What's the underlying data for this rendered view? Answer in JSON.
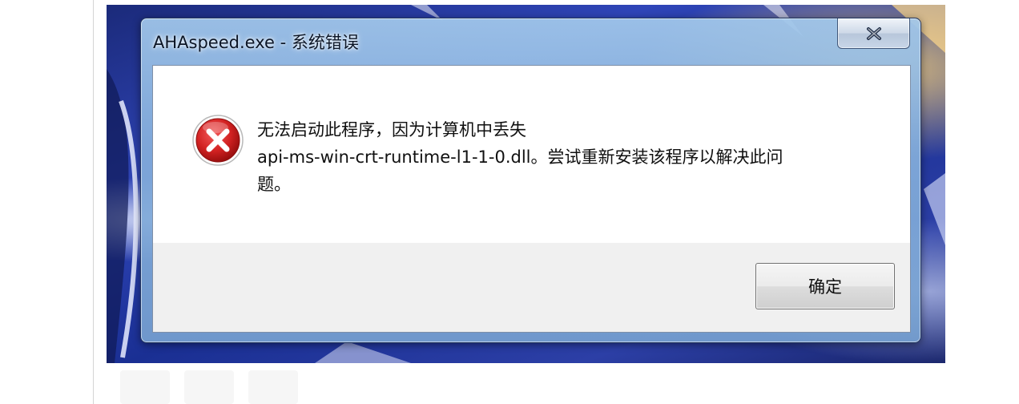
{
  "dialog": {
    "title": "AHAspeed.exe - 系统错误",
    "close_icon": "close-x-icon",
    "status_icon": "error-icon",
    "message": "无法启动此程序，因为计算机中丢失\napi-ms-win-crt-runtime-l1-1-0.dll。尝试重新安装该程序以解决此问\n题。",
    "ok_label": "确定"
  },
  "colors": {
    "error_red": "#d32222",
    "dialog_glass": "#8cb2dc",
    "footer_bg": "#f0f0f0",
    "wallpaper_blue": "#2f45b8"
  }
}
